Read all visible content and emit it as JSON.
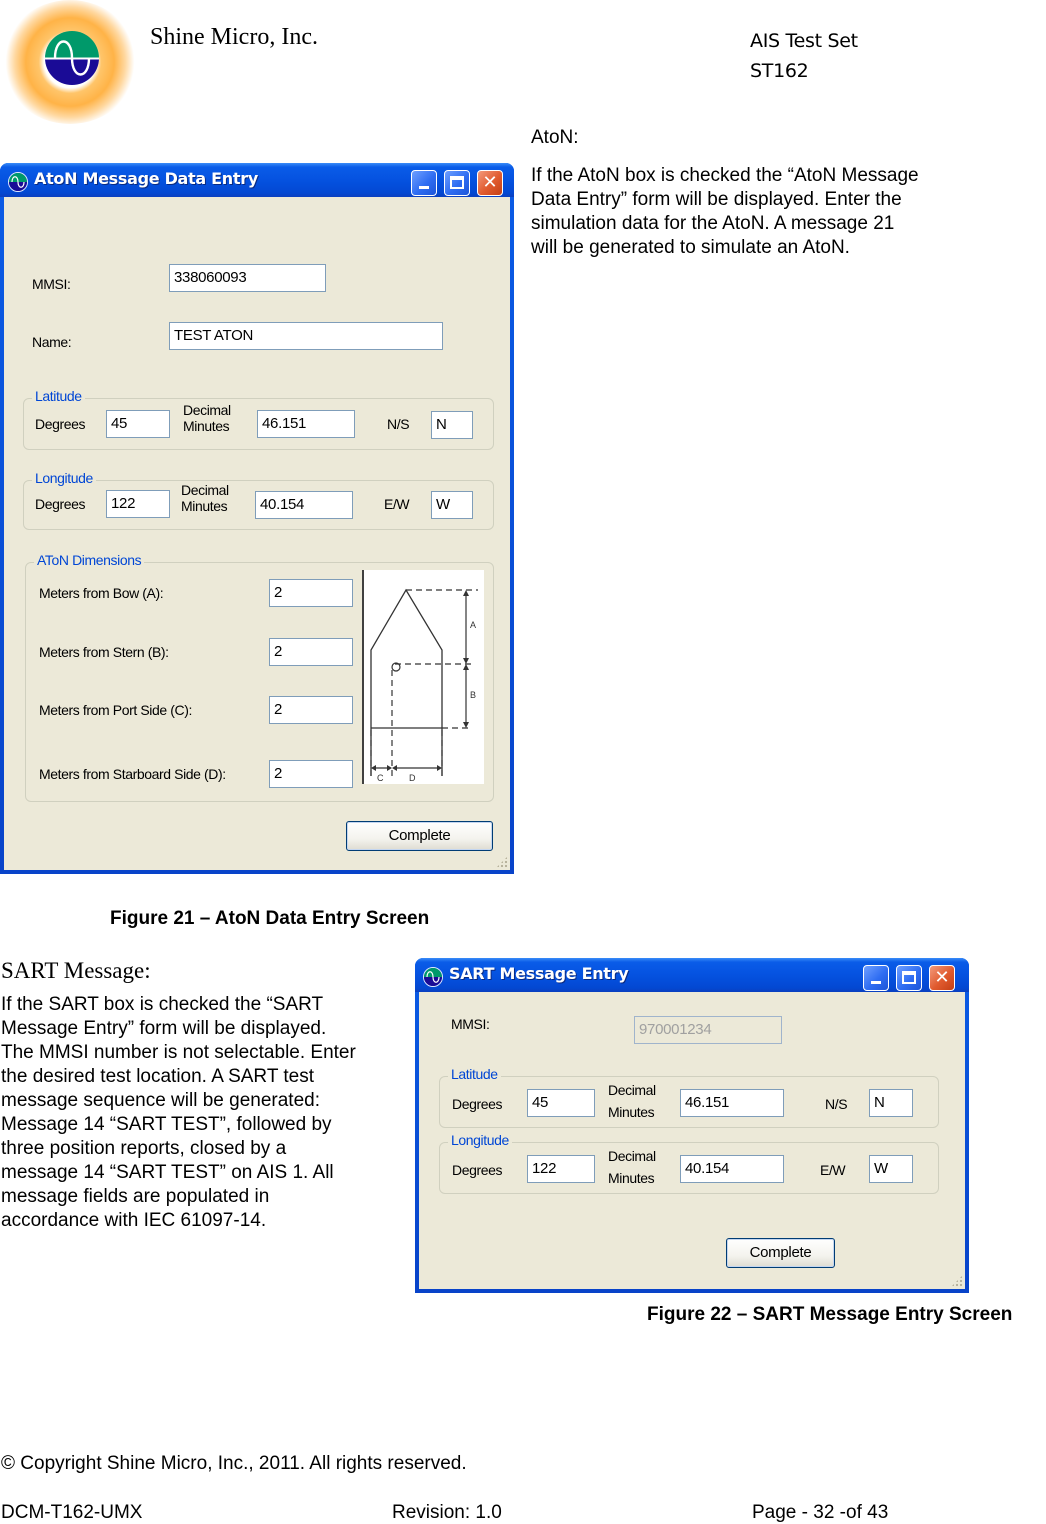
{
  "header": {
    "company": "Shine Micro, Inc.",
    "product_line1": "AIS Test Set",
    "product_line2": "ST162",
    "logo_colors": {
      "top": "#00996a",
      "bottom": "#1a0b96",
      "glow": "#ffb347"
    }
  },
  "aton_section": {
    "heading": "AtoN:",
    "paragraph": "If the AtoN box is checked the “AtoN Message Data Entry” form will be displayed.  Enter the simulation data for the AtoN.  A message 21 will be generated to simulate an AtoN.",
    "paragraph_lines": [
      "If the AtoN box is checked the “AtoN Message",
      "Data Entry” form will be displayed.  Enter the",
      "simulation data for the AtoN.  A message 21",
      "will be generated to simulate an AtoN."
    ],
    "caption": "Figure 21 – AtoN Data Entry Screen"
  },
  "aton_window": {
    "title": "AtoN Message Data Entry",
    "mmsi_label": "MMSI:",
    "mmsi_value": "338060093",
    "name_label": "Name:",
    "name_value": "TEST ATON",
    "latitude": {
      "legend": "Latitude",
      "degrees_label": "Degrees",
      "degrees_value": "45",
      "minutes_label_1": "Decimal",
      "minutes_label_2": "Minutes",
      "minutes_value": "46.151",
      "hemisphere_label": "N/S",
      "hemisphere_value": "N"
    },
    "longitude": {
      "legend": "Longitude",
      "degrees_label": "Degrees",
      "degrees_value": "122",
      "minutes_label_1": "Decimal",
      "minutes_label_2": "Minutes",
      "minutes_value": "40.154",
      "hemisphere_label": "E/W",
      "hemisphere_value": "W"
    },
    "dimensions": {
      "legend": "AToN Dimensions",
      "bow_label": "Meters from Bow (A):",
      "bow_value": "2",
      "stern_label": "Meters from Stern (B):",
      "stern_value": "2",
      "port_label": "Meters from Port Side (C):",
      "port_value": "2",
      "starboard_label": "Meters from Starboard Side (D):",
      "starboard_value": "2",
      "diagram_labels": {
        "a": "A",
        "b": "B",
        "c": "C",
        "d": "D"
      }
    },
    "complete_label": "Complete"
  },
  "sart_section": {
    "heading": "SART Message:",
    "paragraph_lines": [
      "If the SART box is checked the “SART",
      "Message Entry” form will be displayed.",
      "The MMSI number is not selectable.  Enter",
      "the desired test location.  A SART test",
      "message sequence will be generated:",
      "Message 14 “SART TEST”, followed by",
      "three position reports, closed by a",
      "message 14 “SART TEST” on AIS 1.  All",
      "message fields are populated in",
      "accordance with IEC 61097-14."
    ],
    "caption": "Figure 22 – SART Message Entry Screen"
  },
  "sart_window": {
    "title": "SART Message Entry",
    "mmsi_label": "MMSI:",
    "mmsi_value": "970001234",
    "mmsi_disabled": true,
    "latitude": {
      "legend": "Latitude",
      "degrees_label": "Degrees",
      "degrees_value": "45",
      "minutes_label_1": "Decimal",
      "minutes_label_2": "Minutes",
      "minutes_value": "46.151",
      "hemisphere_label": "N/S",
      "hemisphere_value": "N"
    },
    "longitude": {
      "legend": "Longitude",
      "degrees_label": "Degrees",
      "degrees_value": "122",
      "minutes_label_1": "Decimal",
      "minutes_label_2": "Minutes",
      "minutes_value": "40.154",
      "hemisphere_label": "E/W",
      "hemisphere_value": "W"
    },
    "complete_label": "Complete"
  },
  "footer": {
    "copyright": "© Copyright Shine Micro, Inc., 2011.  All rights reserved.",
    "doc_id": "DCM-T162-UMX",
    "revision": "Revision: 1.0",
    "page": "Page - 32 -of 43"
  }
}
